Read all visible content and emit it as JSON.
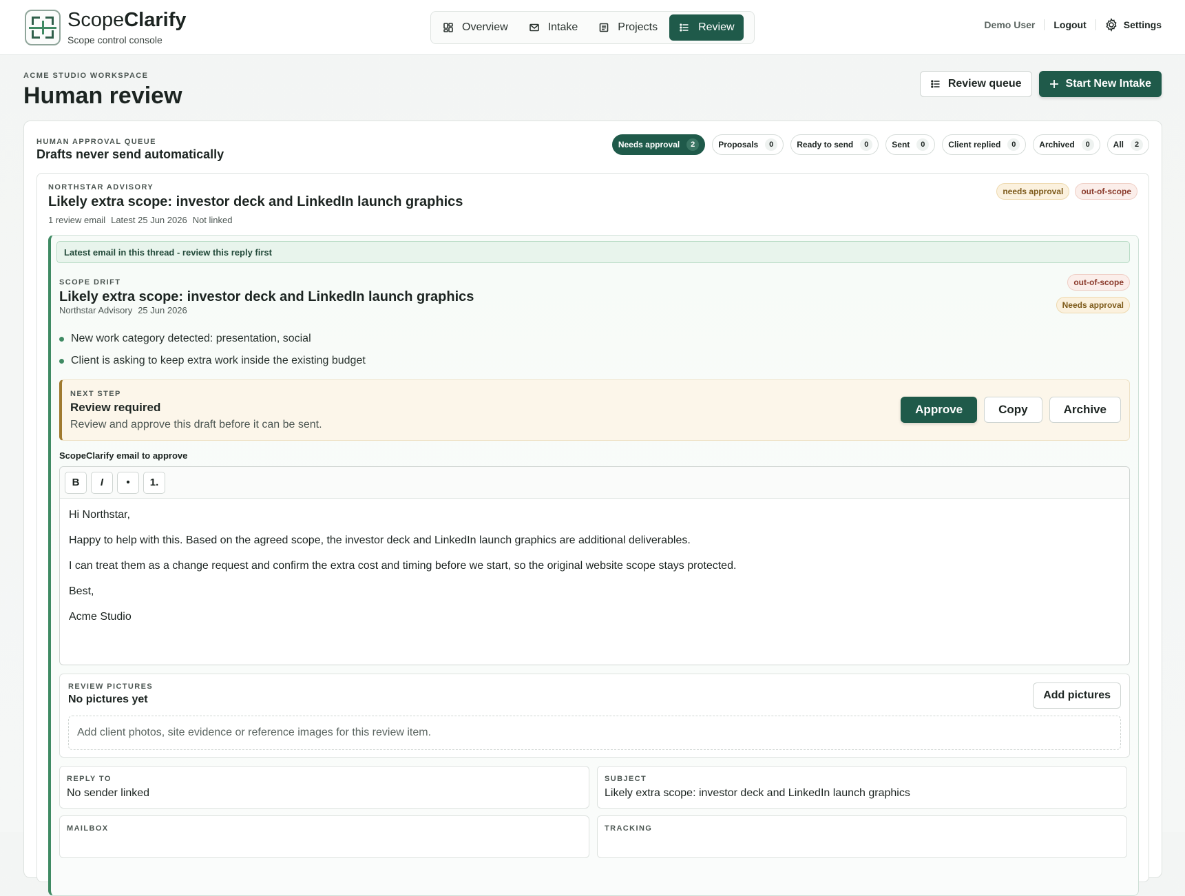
{
  "brand": {
    "name_light": "Scope",
    "name_bold": "Clarify",
    "subtitle": "Scope control console"
  },
  "nav": [
    {
      "label": "Overview",
      "icon": "dashboard-icon",
      "active": false
    },
    {
      "label": "Intake",
      "icon": "mail-icon",
      "active": false
    },
    {
      "label": "Projects",
      "icon": "document-icon",
      "active": false
    },
    {
      "label": "Review",
      "icon": "list-icon",
      "active": true
    }
  ],
  "user": {
    "name": "Demo User",
    "logout": "Logout",
    "settings": "Settings"
  },
  "page": {
    "eyebrow": "ACME STUDIO WORKSPACE",
    "title": "Human review"
  },
  "actions": {
    "review_queue": "Review queue",
    "start_intake": "Start New Intake"
  },
  "queue": {
    "eyebrow": "HUMAN APPROVAL QUEUE",
    "title": "Drafts never send automatically",
    "filters": [
      {
        "label": "Needs approval",
        "count": "2",
        "active": true
      },
      {
        "label": "Proposals",
        "count": "0"
      },
      {
        "label": "Ready to send",
        "count": "0"
      },
      {
        "label": "Sent",
        "count": "0"
      },
      {
        "label": "Client replied",
        "count": "0"
      },
      {
        "label": "Archived",
        "count": "0"
      },
      {
        "label": "All",
        "count": "2"
      }
    ]
  },
  "thread": {
    "client": "NORTHSTAR ADVISORY",
    "title": "Likely extra scope: investor deck and LinkedIn launch graphics",
    "meta": [
      "1 review email",
      "Latest 25 Jun 2026",
      "Not linked"
    ],
    "badges": [
      "needs approval",
      "out-of-scope"
    ]
  },
  "email": {
    "latest_notice": "Latest email in this thread - review this reply first",
    "eyebrow": "SCOPE DRIFT",
    "title": "Likely extra scope: investor deck and LinkedIn launch graphics",
    "from": "Northstar Advisory",
    "date": "25 Jun 2026",
    "badges": [
      "out-of-scope",
      "Needs approval"
    ],
    "bullets": [
      "New work category detected: presentation, social",
      "Client is asking to keep extra work inside the existing budget"
    ],
    "next_step": {
      "eyebrow": "NEXT STEP",
      "title": "Review required",
      "description": "Review and approve this draft before it can be sent.",
      "approve": "Approve",
      "copy": "Copy",
      "archive": "Archive"
    },
    "draft_label": "ScopeClarify email to approve",
    "toolbar": [
      "B",
      "I",
      "•",
      "1."
    ],
    "body": [
      "Hi Northstar,",
      "Happy to help with this. Based on the agreed scope, the investor deck and LinkedIn launch graphics are additional deliverables.",
      "I can treat them as a change request and confirm the extra cost and timing before we start, so the original website scope stays protected.",
      "Best,",
      "Acme Studio"
    ],
    "pictures": {
      "eyebrow": "REVIEW PICTURES",
      "title": "No pictures yet",
      "button": "Add pictures",
      "placeholder": "Add client photos, site evidence or reference images for this review item."
    },
    "fields": [
      {
        "label": "REPLY TO",
        "value": "No sender linked"
      },
      {
        "label": "SUBJECT",
        "value": "Likely extra scope: investor deck and LinkedIn launch graphics"
      },
      {
        "label": "MAILBOX",
        "value": ""
      },
      {
        "label": "TRACKING",
        "value": ""
      }
    ]
  },
  "colors": {
    "accent": "#1f5a4a",
    "green": "#3f8a63",
    "amber": "#a07a2f"
  }
}
